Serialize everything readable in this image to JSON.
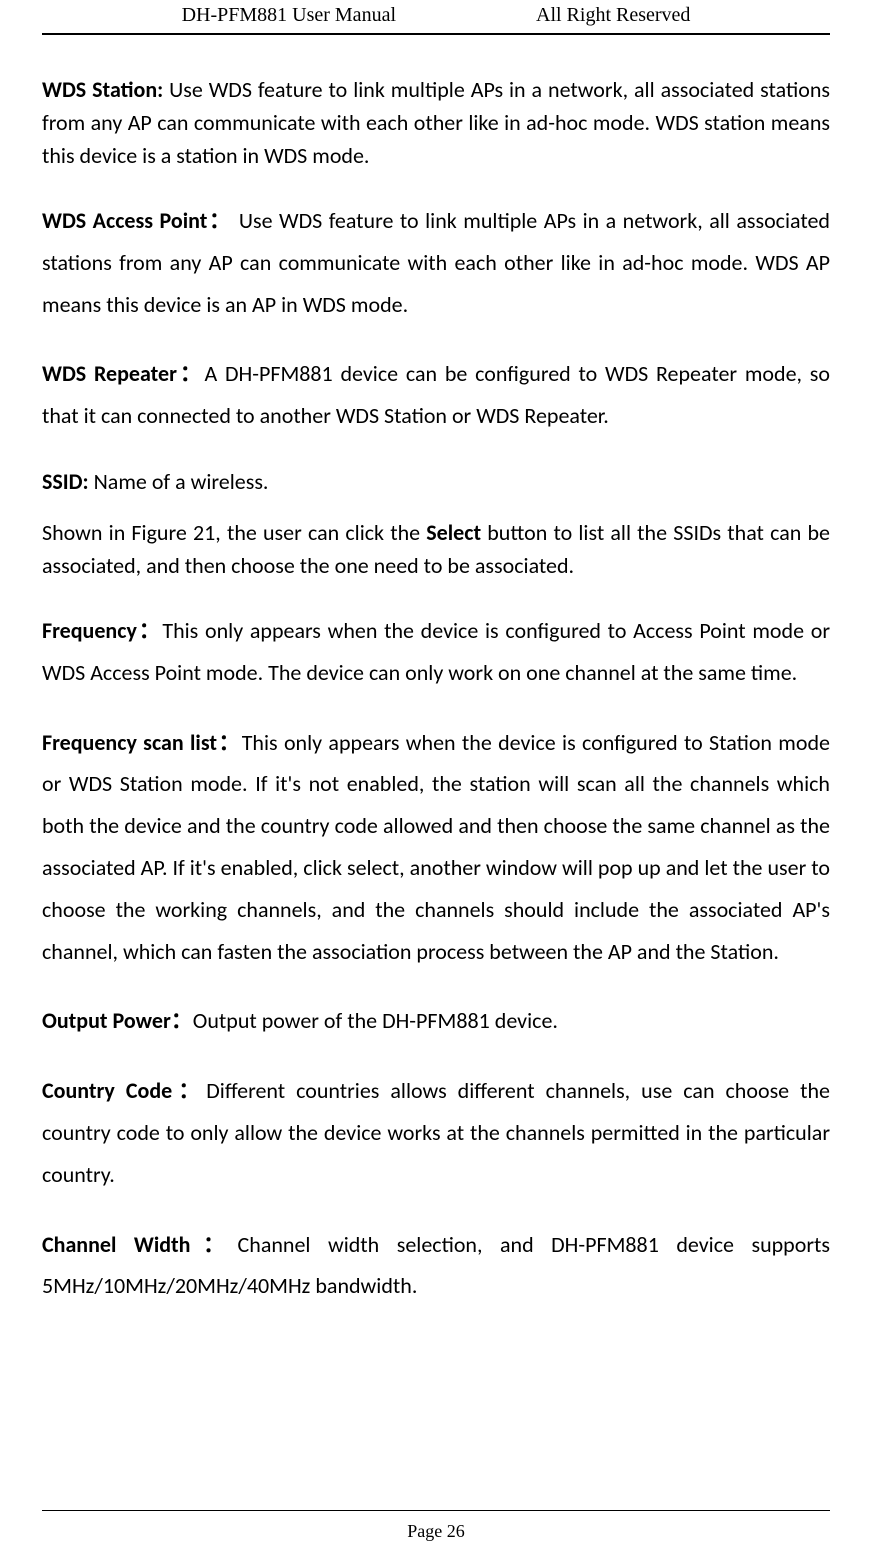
{
  "header": {
    "left": "DH-PFM881 User Manual",
    "right": "All Right Reserved"
  },
  "content": {
    "wds_station": {
      "label": "WDS Station:",
      "text": " Use WDS feature to link multiple APs in a network, all associated stations from any AP can communicate with each other like in ad-hoc mode. WDS station means this device is a station in WDS mode."
    },
    "wds_ap": {
      "label": "WDS Access Point：",
      "text": " Use WDS feature to link multiple APs in a network, all associated stations from any AP can communicate with each other like in ad-hoc mode. WDS AP means this device is an AP in WDS mode."
    },
    "wds_repeater": {
      "label": "WDS Repeater：",
      "text": "A DH-PFM881 device can be configured to WDS Repeater mode, so that it can connected to another WDS Station or WDS Repeater."
    },
    "ssid": {
      "label": "SSID:",
      "text": " Name of a wireless."
    },
    "shown": {
      "prefix": "Shown in Figure 21, the user can click the ",
      "bold": "Select",
      "suffix": " button to list all the SSIDs that can be associated, and then choose the one need to be associated."
    },
    "frequency": {
      "label": "Frequency：",
      "text": "This only appears when the device is configured to Access Point mode or WDS Access Point mode. The device can only work on one channel at the same time."
    },
    "freq_scan": {
      "label": "Frequency scan list：",
      "text": "This only appears when the device is configured to Station mode or WDS Station mode. If it's not enabled, the station will scan all the channels which both the device and the country code allowed and then choose the same channel as the associated AP. If it's enabled, click select, another window will pop up and let the user to choose the working channels, and the channels should include the associated AP's channel, which can fasten the association process between the AP and the Station."
    },
    "output_power": {
      "label": "Output Power：",
      "text": "Output power of the DH-PFM881 device."
    },
    "country_code": {
      "label": "Country Code：",
      "text": "Different countries allows different channels, use can choose the country code to only allow the device works at the channels permitted in the particular country."
    },
    "channel_width": {
      "label": "Channel Width：",
      "text": "Channel width selection, and DH-PFM881 device supports 5MHz/10MHz/20MHz/40MHz bandwidth."
    }
  },
  "footer": {
    "page": "Page 26"
  }
}
